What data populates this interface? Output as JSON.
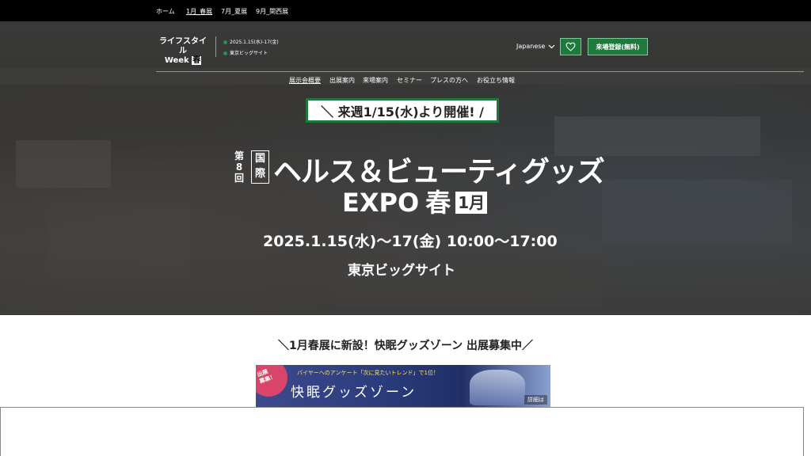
{
  "topnav": {
    "items": [
      "ホーム",
      "1月_春展",
      "7月_夏展",
      "9月_関西展"
    ]
  },
  "header": {
    "logo_line1": "ライフスタイル",
    "logo_line2": "Week",
    "logo_badge": "春",
    "info_date": "2025.1.15(水)-17(金)",
    "info_venue": "東京ビッグサイト",
    "language": "Japanese",
    "register_label": "来場登録(無料)"
  },
  "subnav": {
    "items": [
      "展示会概要",
      "出展案内",
      "来場案内",
      "セミナー",
      "プレスの方へ",
      "お役立ち情報"
    ]
  },
  "hero": {
    "notice": "＼ 来週1/15(水)より開催! /",
    "edition_top": "第",
    "edition_num": "8",
    "edition_bottom": "回",
    "intl_top": "国",
    "intl_bottom": "際",
    "title_line1": "ヘルス＆ビューティグッズ",
    "title_expo": "EXPO",
    "title_season": "春",
    "title_month": "1月",
    "dates": "2025.1.15(水)～17(金)  10:00～17:00",
    "venue": "東京ビッグサイト"
  },
  "section": {
    "heading": "＼1月春展に新設！快眠グッズゾーン 出展募集中／"
  },
  "banner": {
    "corner_line1": "出展",
    "corner_line2": "募集！",
    "survey": "バイヤーへのアンケート「次に見たいトレンド」で1位！",
    "zone": "快眠グッズゾーン",
    "detail": "詳細は"
  },
  "colors": {
    "brand_green": "#1e7a3c",
    "topnav_bg": "#000000",
    "banner_pink": "#d9456a"
  }
}
